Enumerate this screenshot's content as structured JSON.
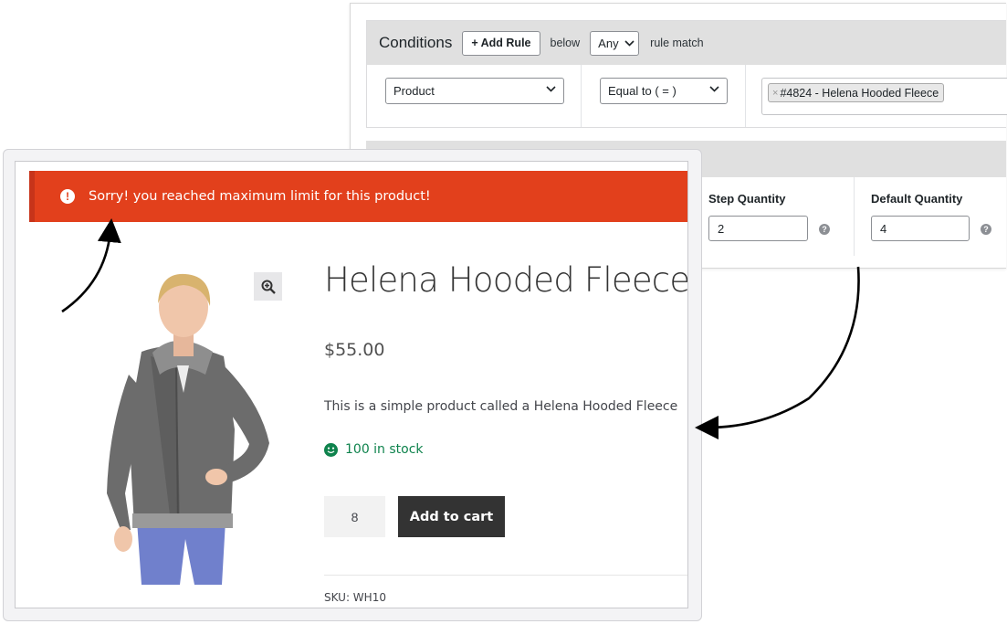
{
  "conditions": {
    "title": "Conditions",
    "add_rule_label": "+ Add Rule",
    "below_text": "below",
    "match_select": "Any",
    "rule_match_text": "rule match",
    "rule": {
      "field": "Product",
      "operator": "Equal to ( = )",
      "value_token": "#4824 - Helena Hooded Fleece",
      "token_remove": "×"
    }
  },
  "quantity_settings": {
    "step_label": "Step Quantity",
    "step_value": "2",
    "default_label": "Default Quantity",
    "default_value": "4",
    "help_glyph": "?"
  },
  "notice": {
    "icon_glyph": "!",
    "text": "Sorry! you reached maximum limit for this product!",
    "color": "#e2401c"
  },
  "product": {
    "title": "Helena Hooded Fleece",
    "price": "$55.00",
    "description": "This is a simple product called a Helena Hooded Fleece",
    "stock": "100 in stock",
    "quantity": "8",
    "add_to_cart_label": "Add to cart",
    "sku": "SKU: WH10",
    "stock_color": "#0f834d"
  },
  "icons": {
    "zoom": "zoom-in-icon",
    "stock": "smile-icon",
    "chevron": "chevron-down-icon",
    "notice": "exclamation-circle-icon",
    "help": "question-circle-icon"
  }
}
